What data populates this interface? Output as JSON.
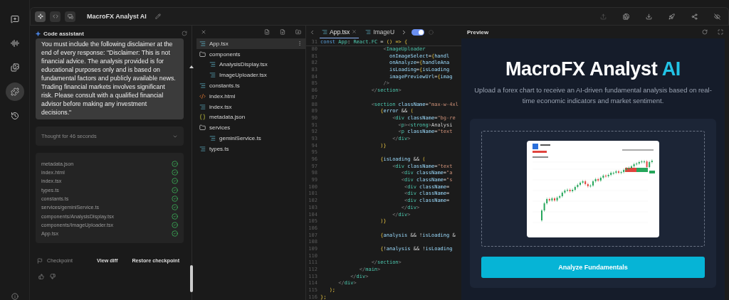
{
  "rail": {
    "items": [
      {
        "kind": "chat",
        "selected": false
      },
      {
        "kind": "audio",
        "selected": false
      },
      {
        "kind": "gallery",
        "selected": false
      },
      {
        "kind": "puzzle",
        "selected": true
      },
      {
        "kind": "history",
        "selected": false
      }
    ]
  },
  "toolbar": {
    "modes": [
      {
        "kind": "sparkle",
        "selected": true
      },
      {
        "kind": "code",
        "selected": false
      },
      {
        "kind": "device",
        "selected": false
      }
    ],
    "title": "MacroFX Analyst AI",
    "actions": [
      {
        "kind": "upload",
        "disabled": true
      },
      {
        "kind": "save",
        "disabled": false
      },
      {
        "kind": "download",
        "disabled": false
      },
      {
        "kind": "rocket",
        "disabled": false
      },
      {
        "kind": "share",
        "disabled": false
      },
      {
        "kind": "hide",
        "disabled": false
      }
    ]
  },
  "chat": {
    "title": "Code assistant",
    "message": "You must include the following disclaimer at the end of every response: \"Disclaimer: This is not financial advice. The analysis provided is for educational purposes only and is based on fundamental factors and publicly available news. Trading financial markets involves significant risk. Please consult with a qualified financial advisor before making any investment decisions.\"",
    "thought": {
      "label": "Thought for 46 seconds",
      "expanded": false
    },
    "files": [
      {
        "name": "metadata.json",
        "done": true
      },
      {
        "name": "index.html",
        "done": true
      },
      {
        "name": "index.tsx",
        "done": true
      },
      {
        "name": "types.ts",
        "done": true
      },
      {
        "name": "constants.ts",
        "done": true
      },
      {
        "name": "services/geminiService.ts",
        "done": true
      },
      {
        "name": "components/AnalysisDisplay.tsx",
        "done": true
      },
      {
        "name": "components/ImageUploader.tsx",
        "done": true
      },
      {
        "name": "App.tsx",
        "done": true
      }
    ],
    "checkpoint": {
      "label": "Checkpoint",
      "view_diff": "View diff",
      "restore": "Restore checkpoint"
    }
  },
  "file_tree": {
    "items": [
      {
        "name": "App.tsx",
        "kind": "code",
        "selected": true
      },
      {
        "name": "components",
        "kind": "folder",
        "selected": false,
        "children": [
          {
            "name": "AnalysisDisplay.tsx",
            "kind": "code",
            "selected": false
          },
          {
            "name": "ImageUploader.tsx",
            "kind": "code",
            "selected": false
          }
        ]
      },
      {
        "name": "constants.ts",
        "kind": "code",
        "selected": false
      },
      {
        "name": "index.html",
        "kind": "html",
        "selected": false
      },
      {
        "name": "index.tsx",
        "kind": "code",
        "selected": false
      },
      {
        "name": "metadata.json",
        "kind": "json",
        "selected": false
      },
      {
        "name": "services",
        "kind": "folder",
        "selected": false,
        "children": [
          {
            "name": "geminiService.ts",
            "kind": "code",
            "selected": false
          }
        ]
      },
      {
        "name": "types.ts",
        "kind": "code",
        "selected": false
      }
    ]
  },
  "editor": {
    "tabs": [
      {
        "label": "App.tsx",
        "selected": true,
        "closable": true
      },
      {
        "label": "ImageU",
        "selected": false,
        "closable": false
      }
    ],
    "toggle_on": true,
    "sticky": {
      "number": "31",
      "tokens": [
        {
          "kind": "kw",
          "text": "const "
        },
        {
          "kind": "type",
          "text": "App"
        },
        {
          "kind": "plain",
          "text": ": "
        },
        {
          "kind": "type",
          "text": "React.FC"
        },
        {
          "kind": "plain",
          "text": " = "
        },
        {
          "kind": "brace",
          "text": "() => {"
        }
      ]
    },
    "lines": [
      {
        "number": "80",
        "tokens": [
          {
            "kind": "punct",
            "text": "                     <"
          },
          {
            "kind": "tag",
            "text": "ImageUploader"
          }
        ]
      },
      {
        "number": "81",
        "tokens": [
          {
            "kind": "attr",
            "text": "                       onImageSelect"
          },
          {
            "kind": "plain",
            "text": "="
          },
          {
            "kind": "brace",
            "text": "{"
          },
          {
            "kind": "var",
            "text": "handl"
          }
        ]
      },
      {
        "number": "82",
        "tokens": [
          {
            "kind": "attr",
            "text": "                       onAnalyze"
          },
          {
            "kind": "plain",
            "text": "="
          },
          {
            "kind": "brace",
            "text": "{"
          },
          {
            "kind": "var",
            "text": "handleAna"
          }
        ]
      },
      {
        "number": "83",
        "tokens": [
          {
            "kind": "attr",
            "text": "                       isLoading"
          },
          {
            "kind": "plain",
            "text": "="
          },
          {
            "kind": "brace",
            "text": "{"
          },
          {
            "kind": "var",
            "text": "isLoading"
          }
        ]
      },
      {
        "number": "84",
        "tokens": [
          {
            "kind": "attr",
            "text": "                       imagePreviewUrl"
          },
          {
            "kind": "plain",
            "text": "="
          },
          {
            "kind": "brace",
            "text": "{"
          },
          {
            "kind": "var",
            "text": "imag"
          }
        ]
      },
      {
        "number": "85",
        "tokens": [
          {
            "kind": "punct",
            "text": "                     />"
          }
        ]
      },
      {
        "number": "86",
        "tokens": [
          {
            "kind": "punct",
            "text": "                 </"
          },
          {
            "kind": "tag",
            "text": "section"
          },
          {
            "kind": "punct",
            "text": ">"
          }
        ]
      },
      {
        "number": "87"
      },
      {
        "number": "88",
        "tokens": [
          {
            "kind": "punct",
            "text": "                 <"
          },
          {
            "kind": "tag",
            "text": "section"
          },
          {
            "kind": "attr",
            "text": " className"
          },
          {
            "kind": "plain",
            "text": "="
          },
          {
            "kind": "str",
            "text": "\"max-w-4xl"
          }
        ]
      },
      {
        "number": "89",
        "tokens": [
          {
            "kind": "brace",
            "text": "                    {"
          },
          {
            "kind": "var",
            "text": "error"
          },
          {
            "kind": "plain",
            "text": " && "
          },
          {
            "kind": "brace",
            "text": "("
          }
        ]
      },
      {
        "number": "90",
        "tokens": [
          {
            "kind": "punct",
            "text": "                        <"
          },
          {
            "kind": "tag",
            "text": "div"
          },
          {
            "kind": "attr",
            "text": " className"
          },
          {
            "kind": "plain",
            "text": "="
          },
          {
            "kind": "str",
            "text": "\"bg-re"
          }
        ]
      },
      {
        "number": "91",
        "tokens": [
          {
            "kind": "punct",
            "text": "                          <"
          },
          {
            "kind": "tag",
            "text": "p"
          },
          {
            "kind": "punct",
            "text": "><"
          },
          {
            "kind": "tag",
            "text": "strong"
          },
          {
            "kind": "punct",
            "text": ">"
          },
          {
            "kind": "plain",
            "text": "Analysi"
          }
        ]
      },
      {
        "number": "92",
        "tokens": [
          {
            "kind": "punct",
            "text": "                          <"
          },
          {
            "kind": "tag",
            "text": "p"
          },
          {
            "kind": "attr",
            "text": " className"
          },
          {
            "kind": "plain",
            "text": "="
          },
          {
            "kind": "str",
            "text": "\"text"
          }
        ]
      },
      {
        "number": "93",
        "tokens": [
          {
            "kind": "punct",
            "text": "                        </"
          },
          {
            "kind": "tag",
            "text": "div"
          },
          {
            "kind": "punct",
            "text": ">"
          }
        ]
      },
      {
        "number": "94",
        "tokens": [
          {
            "kind": "brace",
            "text": "                    )}"
          }
        ]
      },
      {
        "number": "95"
      },
      {
        "number": "96",
        "tokens": [
          {
            "kind": "brace",
            "text": "                    {"
          },
          {
            "kind": "var",
            "text": "isLoading"
          },
          {
            "kind": "plain",
            "text": " && "
          },
          {
            "kind": "brace",
            "text": "("
          }
        ]
      },
      {
        "number": "97",
        "tokens": [
          {
            "kind": "punct",
            "text": "                        <"
          },
          {
            "kind": "tag",
            "text": "div"
          },
          {
            "kind": "attr",
            "text": " className"
          },
          {
            "kind": "plain",
            "text": "="
          },
          {
            "kind": "str",
            "text": "\"text"
          }
        ]
      },
      {
        "number": "98",
        "tokens": [
          {
            "kind": "punct",
            "text": "                           <"
          },
          {
            "kind": "tag",
            "text": "div"
          },
          {
            "kind": "attr",
            "text": " className"
          },
          {
            "kind": "plain",
            "text": "="
          },
          {
            "kind": "str",
            "text": "\"a"
          }
        ]
      },
      {
        "number": "99",
        "tokens": [
          {
            "kind": "punct",
            "text": "                           <"
          },
          {
            "kind": "tag",
            "text": "div"
          },
          {
            "kind": "attr",
            "text": " className"
          },
          {
            "kind": "plain",
            "text": "="
          },
          {
            "kind": "str",
            "text": "\"s"
          }
        ]
      },
      {
        "number": "100",
        "tokens": [
          {
            "kind": "punct",
            "text": "                            <"
          },
          {
            "kind": "tag",
            "text": "div"
          },
          {
            "kind": "attr",
            "text": " className"
          },
          {
            "kind": "plain",
            "text": "="
          }
        ]
      },
      {
        "number": "101",
        "tokens": [
          {
            "kind": "punct",
            "text": "                            <"
          },
          {
            "kind": "tag",
            "text": "div"
          },
          {
            "kind": "attr",
            "text": " className"
          },
          {
            "kind": "plain",
            "text": "="
          }
        ]
      },
      {
        "number": "102",
        "tokens": [
          {
            "kind": "punct",
            "text": "                            <"
          },
          {
            "kind": "tag",
            "text": "div"
          },
          {
            "kind": "attr",
            "text": " className"
          },
          {
            "kind": "plain",
            "text": "="
          }
        ]
      },
      {
        "number": "103",
        "tokens": [
          {
            "kind": "punct",
            "text": "                           </"
          },
          {
            "kind": "tag",
            "text": "div"
          },
          {
            "kind": "punct",
            "text": ">"
          }
        ]
      },
      {
        "number": "104",
        "tokens": [
          {
            "kind": "punct",
            "text": "                        </"
          },
          {
            "kind": "tag",
            "text": "div"
          },
          {
            "kind": "punct",
            "text": ">"
          }
        ]
      },
      {
        "number": "105",
        "tokens": [
          {
            "kind": "brace",
            "text": "                    )}"
          }
        ]
      },
      {
        "number": "106"
      },
      {
        "number": "107",
        "tokens": [
          {
            "kind": "brace",
            "text": "                    {"
          },
          {
            "kind": "var",
            "text": "analysis"
          },
          {
            "kind": "plain",
            "text": " && !"
          },
          {
            "kind": "var",
            "text": "isLoading"
          },
          {
            "kind": "plain",
            "text": " &"
          }
        ]
      },
      {
        "number": "108"
      },
      {
        "number": "109",
        "tokens": [
          {
            "kind": "brace",
            "text": "                    {"
          },
          {
            "kind": "plain",
            "text": "!"
          },
          {
            "kind": "var",
            "text": "analysis"
          },
          {
            "kind": "plain",
            "text": " && !"
          },
          {
            "kind": "var",
            "text": "isLoading"
          }
        ]
      },
      {
        "number": "110"
      },
      {
        "number": "111",
        "tokens": [
          {
            "kind": "punct",
            "text": "                 </"
          },
          {
            "kind": "tag",
            "text": "section"
          },
          {
            "kind": "punct",
            "text": ">"
          }
        ]
      },
      {
        "number": "112",
        "tokens": [
          {
            "kind": "punct",
            "text": "             </"
          },
          {
            "kind": "tag",
            "text": "main"
          },
          {
            "kind": "punct",
            "text": ">"
          }
        ]
      },
      {
        "number": "113",
        "tokens": [
          {
            "kind": "punct",
            "text": "          </"
          },
          {
            "kind": "tag",
            "text": "div"
          },
          {
            "kind": "punct",
            "text": ">"
          }
        ]
      },
      {
        "number": "114",
        "tokens": [
          {
            "kind": "punct",
            "text": "      </"
          },
          {
            "kind": "tag",
            "text": "div"
          },
          {
            "kind": "punct",
            "text": ">"
          }
        ]
      },
      {
        "number": "115",
        "tokens": [
          {
            "kind": "brace",
            "text": "   );"
          }
        ]
      },
      {
        "number": "116",
        "tokens": [
          {
            "kind": "brace",
            "text": "};"
          }
        ]
      }
    ]
  },
  "preview": {
    "title": "Preview",
    "heading": "MacroFX Analyst",
    "heading_accent": "AI",
    "subtitle": "Upload a forex chart to receive an AI-driven fundamental analysis based on real-time economic indicators and market sentiment.",
    "button": "Analyze Fundamentals"
  }
}
